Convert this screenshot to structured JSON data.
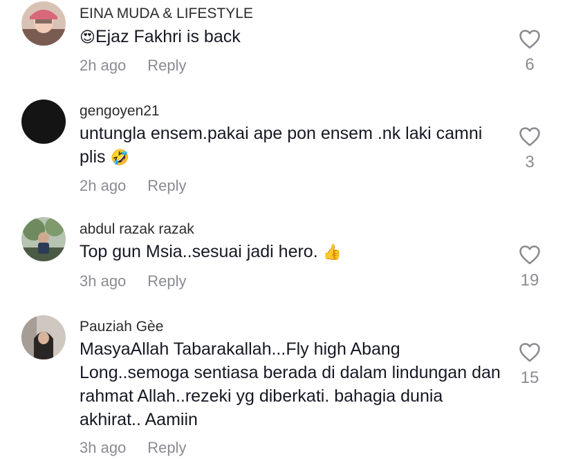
{
  "comments": [
    {
      "username": "EINA MUDA & LIFESTYLE",
      "emoji_prefix": "😍",
      "text": "Ejaz Fakhri is back",
      "emoji_suffix": "",
      "time": "2h ago",
      "reply_label": "Reply",
      "likes": "6",
      "avatar_color": "#c9a7a0"
    },
    {
      "username": "gengoyen21",
      "emoji_prefix": "",
      "text": "untungla ensem.pakai ape pon ensem .nk laki camni plis",
      "emoji_suffix": "🤣",
      "time": "2h ago",
      "reply_label": "Reply",
      "likes": "3",
      "avatar_color": "#141414"
    },
    {
      "username": "abdul razak razak",
      "emoji_prefix": "",
      "text": "Top gun Msia..sesuai jadi hero.",
      "emoji_suffix": "👍",
      "time": "3h ago",
      "reply_label": "Reply",
      "likes": "19",
      "avatar_color": "#8a9a7a"
    },
    {
      "username": "Pauziah Gèe",
      "emoji_prefix": "",
      "text": "MasyaAllah Tabarakallah...Fly high Abang Long..semoga sentiasa berada di dalam lindungan dan rahmat Allah..rezeki yg diberkati. bahagia dunia akhirat.. Aamiin",
      "emoji_suffix": "",
      "time": "3h ago",
      "reply_label": "Reply",
      "likes": "15",
      "avatar_color": "#b9b3ad"
    }
  ],
  "colors": {
    "text": "#161823",
    "muted": "#8a8b91",
    "background": "#ffffff"
  },
  "icons": {
    "like": "heart-outline-icon"
  }
}
